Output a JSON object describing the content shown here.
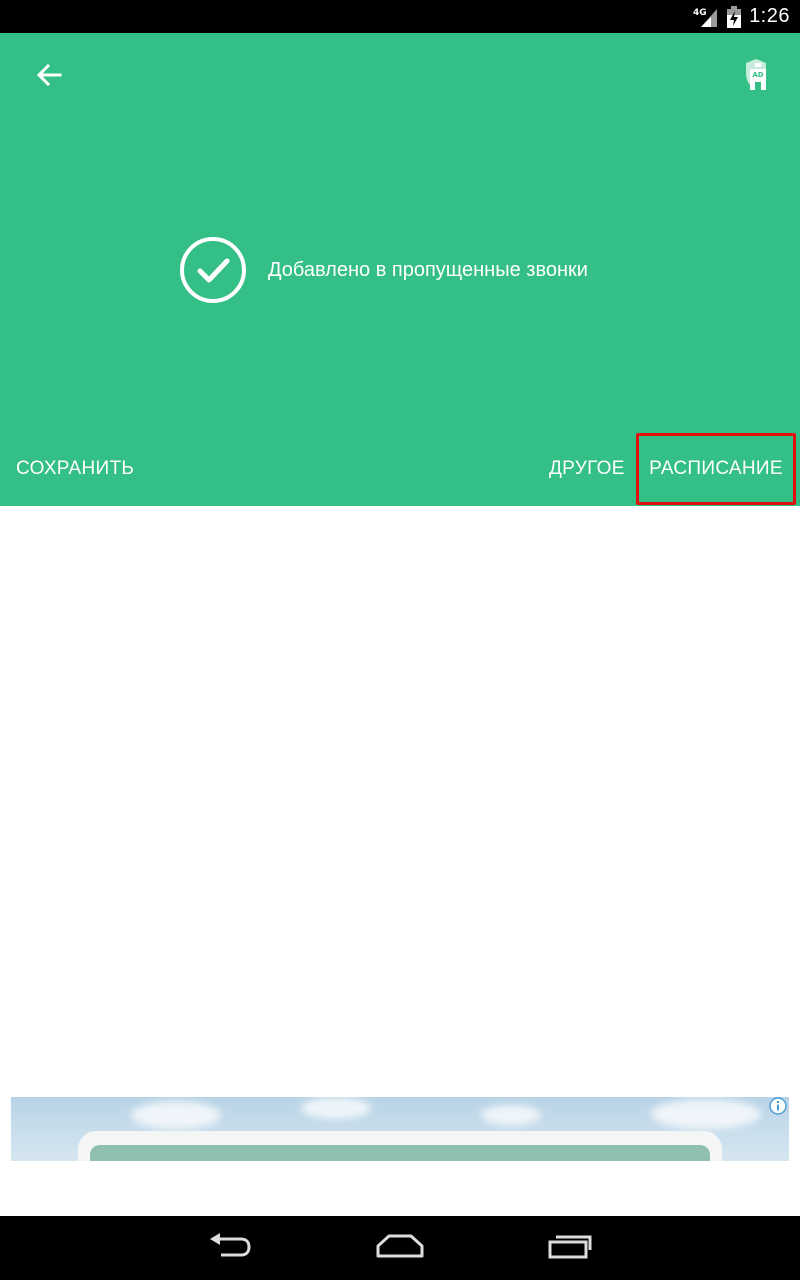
{
  "status_bar": {
    "network": "4G",
    "time": "1:26"
  },
  "header": {
    "background_color": "#33bf86",
    "back_icon": "arrow-left-icon",
    "ad_block_icon": "ad-block-icon",
    "ad_block_badge": "AD",
    "confirmation_icon": "check-circle-icon",
    "confirmation_text": "Добавлено в пропущенные звонки"
  },
  "actions": {
    "save_label": "СОХРАНИТЬ",
    "other_label": "ДРУГОЕ",
    "schedule_label": "РАСПИСАНИЕ",
    "highlight_color": "#e01010"
  },
  "ad": {
    "info_icon": "info-icon"
  },
  "nav_bar": {
    "back_icon": "nav-back-icon",
    "home_icon": "nav-home-icon",
    "recents_icon": "nav-recents-icon"
  }
}
